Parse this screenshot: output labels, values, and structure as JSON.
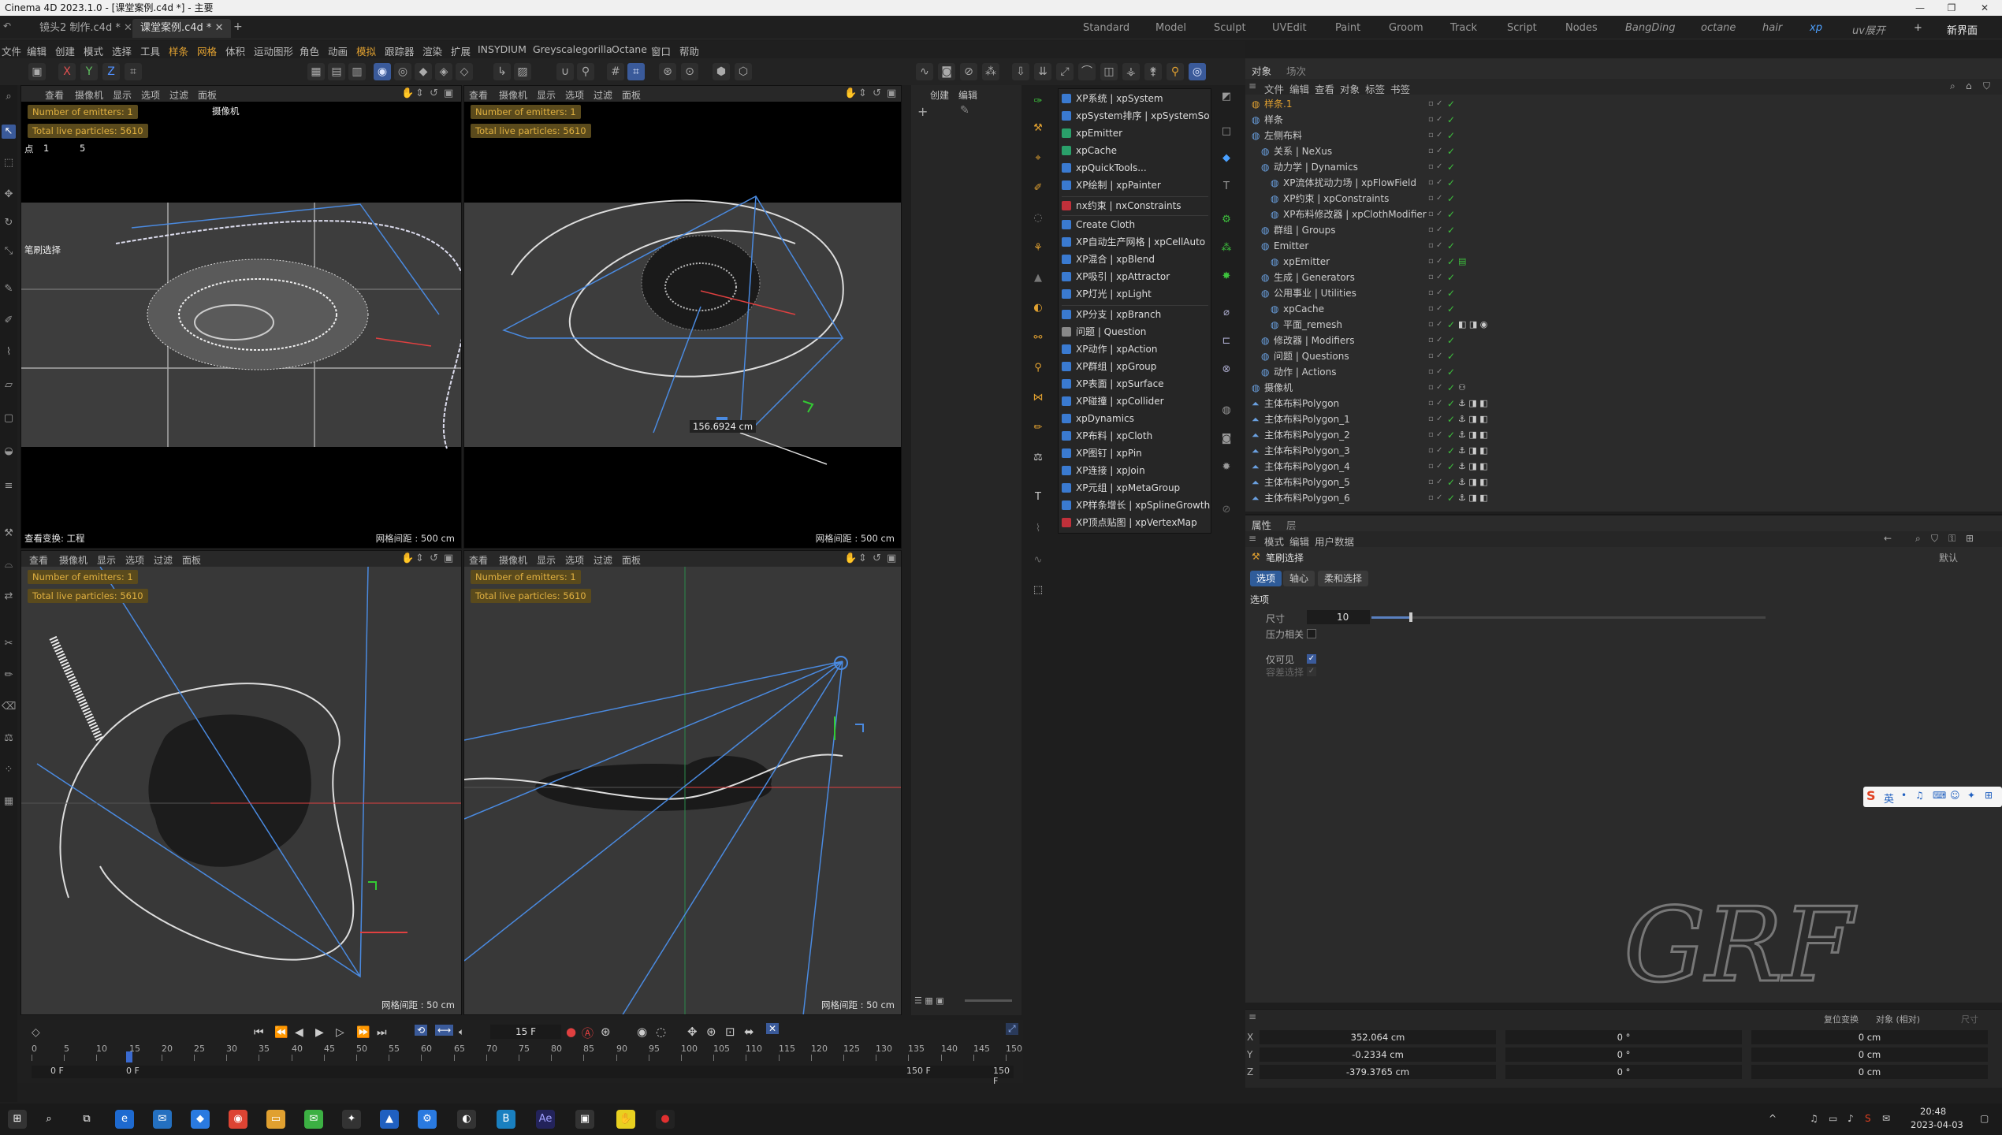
{
  "window": {
    "title": "Cinema 4D 2023.1.0 - [课堂案例.c4d *] - 主要"
  },
  "doc_tabs": [
    {
      "label": "镜头2 制作.c4d *"
    },
    {
      "label": "课堂案例.c4d *"
    }
  ],
  "layouts": [
    "Standard",
    "Model",
    "Sculpt",
    "UVEdit",
    "Paint",
    "Groom",
    "Track",
    "Script",
    "Nodes",
    "BangDing",
    "octane",
    "hair",
    "xp",
    "uv展开",
    "+",
    "新界面"
  ],
  "menu": [
    "文件",
    "编辑",
    "创建",
    "模式",
    "选择",
    "工具",
    "样条",
    "网格",
    "体积",
    "运动图形",
    "角色",
    "动画",
    "模拟",
    "跟踪器",
    "渲染",
    "扩展",
    "INSYDIUM",
    "Greyscalegorilla",
    "Octane",
    "窗口",
    "帮助"
  ],
  "viewport_menu": [
    "查看",
    "摄像机",
    "显示",
    "选项",
    "过滤",
    "面板"
  ],
  "hud": {
    "emitters": "Number of emitters: 1",
    "particles": "Total live particles: 5610"
  },
  "viewports": [
    {
      "grid": "网格间距 : 500 cm",
      "camera": "摄像机",
      "extra": "点",
      "n1": "1",
      "n2": "5",
      "sel": "笔刷选择",
      "transform": "查看变换: 工程"
    },
    {
      "grid": "网格间距 : 500 cm",
      "measure": "156.6924 cm"
    },
    {
      "grid": "网格间距 : 50 cm"
    },
    {
      "grid": "网格间距 : 50 cm"
    }
  ],
  "create_panel": {
    "tab1": "创建",
    "tab2": "编辑"
  },
  "xp_menu": [
    {
      "label": "XP系统 | xpSystem",
      "color": "#3a7ad0"
    },
    {
      "label": "xpSystem排序 | xpSystemSort",
      "color": "#3a7ad0"
    },
    {
      "label": "xpEmitter",
      "color": "#2aa06a"
    },
    {
      "label": "xpCache",
      "color": "#2aa06a"
    },
    {
      "label": "xpQuickTools...",
      "color": "#3a7ad0"
    },
    {
      "label": "XP绘制 | xpPainter",
      "color": "#3a7ad0"
    },
    {
      "label": "nx约束 | nxConstraints",
      "color": "#c0303a"
    },
    {
      "label": "Create Cloth",
      "color": "#3a7ad0"
    },
    {
      "label": "XP自动生产网格 | xpCellAuto",
      "color": "#3a7ad0"
    },
    {
      "label": "XP混合 | xpBlend",
      "color": "#3a7ad0"
    },
    {
      "label": "XP吸引 | xpAttractor",
      "color": "#3a7ad0"
    },
    {
      "label": "XP灯光 | xpLight",
      "color": "#3a7ad0"
    },
    {
      "label": "XP分支 | xpBranch",
      "color": "#3a7ad0"
    },
    {
      "label": "问题 | Question",
      "color": "#888888"
    },
    {
      "label": "XP动作 | xpAction",
      "color": "#3a7ad0"
    },
    {
      "label": "XP群组 | xpGroup",
      "color": "#3a7ad0"
    },
    {
      "label": "XP表面 | xpSurface",
      "color": "#3a7ad0"
    },
    {
      "label": "XP碰撞 | xpCollider",
      "color": "#3a7ad0"
    },
    {
      "label": "xpDynamics",
      "color": "#3a7ad0"
    },
    {
      "label": "XP布料 | xpCloth",
      "color": "#3a7ad0"
    },
    {
      "label": "XP图钉 | xpPin",
      "color": "#3a7ad0"
    },
    {
      "label": "XP连接 | xpJoin",
      "color": "#3a7ad0"
    },
    {
      "label": "XP元组 | xpMetaGroup",
      "color": "#3a7ad0"
    },
    {
      "label": "XP样条增长 | xpSplineGrowth",
      "color": "#3a7ad0"
    },
    {
      "label": "XP顶点贴图 | xpVertexMap",
      "color": "#c0303a"
    }
  ],
  "obj_panel": {
    "tabs": [
      "对象",
      "场次"
    ],
    "menu": [
      "文件",
      "编辑",
      "查看",
      "对象",
      "标签",
      "书签"
    ],
    "rows": [
      {
        "label": "样条.1",
        "color": "#e0a030"
      },
      {
        "label": "样条",
        "color": "#ccc"
      },
      {
        "label": "左侧布料",
        "color": "#ccc"
      },
      {
        "label": "关系 | NeXus",
        "color": "#ccc"
      },
      {
        "label": "动力学 | Dynamics",
        "color": "#ccc"
      },
      {
        "label": "XP流体扰动力场 | xpFlowField",
        "color": "#ccc"
      },
      {
        "label": "XP约束 | xpConstraints",
        "color": "#ccc"
      },
      {
        "label": "XP布料修改器 | xpClothModifier",
        "color": "#ccc"
      },
      {
        "label": "群组 | Groups",
        "color": "#ccc"
      },
      {
        "label": "Emitter",
        "color": "#ccc"
      },
      {
        "label": "xpEmitter",
        "color": "#ccc"
      },
      {
        "label": "生成 | Generators",
        "color": "#ccc"
      },
      {
        "label": "公用事业 | Utilities",
        "color": "#ccc"
      },
      {
        "label": "xpCache",
        "color": "#ccc"
      },
      {
        "label": "平面_remesh",
        "color": "#ccc"
      },
      {
        "label": "修改器 | Modifiers",
        "color": "#ccc"
      },
      {
        "label": "问题 | Questions",
        "color": "#ccc"
      },
      {
        "label": "动作 | Actions",
        "color": "#ccc"
      },
      {
        "label": "摄像机",
        "color": "#ccc"
      },
      {
        "label": "主体布料Polygon",
        "color": "#ccc"
      },
      {
        "label": "主体布料Polygon_1",
        "color": "#ccc"
      },
      {
        "label": "主体布料Polygon_2",
        "color": "#ccc"
      },
      {
        "label": "主体布料Polygon_3",
        "color": "#ccc"
      },
      {
        "label": "主体布料Polygon_4",
        "color": "#ccc"
      },
      {
        "label": "主体布料Polygon_5",
        "color": "#ccc"
      },
      {
        "label": "主体布料Polygon_6",
        "color": "#ccc"
      }
    ]
  },
  "attr_panel": {
    "tabs": [
      "属性",
      "层"
    ],
    "menu": [
      "模式",
      "编辑",
      "用户数据"
    ],
    "title": "笔刷选择",
    "buttons": [
      "选项",
      "轴心",
      "柔和选择"
    ],
    "section": "选项",
    "size_label": "尺寸",
    "size_value": "10",
    "size_pct": 0.1,
    "pressure_label": "压力相关",
    "visible_label": "仅可见",
    "tolerance_label": "容差选择",
    "default_label": "默认"
  },
  "coord": {
    "left_btn": "复位变换",
    "mode": "对象 (相对)",
    "size_btn": "尺寸",
    "rows": [
      {
        "axis": "X",
        "pos": "352.064 cm",
        "rot": "0 °",
        "scale": "0 cm"
      },
      {
        "axis": "Y",
        "pos": "-0.2334 cm",
        "rot": "0 °",
        "scale": "0 cm"
      },
      {
        "axis": "Z",
        "pos": "-379.3765 cm",
        "rot": "0 °",
        "scale": "0 cm"
      }
    ]
  },
  "timeline": {
    "ticks": [
      "0",
      "5",
      "10",
      "15",
      "20",
      "25",
      "30",
      "35",
      "40",
      "45",
      "50",
      "55",
      "60",
      "65",
      "70",
      "75",
      "80",
      "85",
      "90",
      "95",
      "100",
      "105",
      "110",
      "115",
      "120",
      "125",
      "130",
      "135",
      "140",
      "145",
      "150"
    ],
    "current_frame": "15 F",
    "start": "0 F",
    "start2": "0 F",
    "end": "150 F",
    "end2": "150 F",
    "playhead_frame": 15,
    "max_frame": 150
  },
  "watermark": "GRF",
  "tray": {
    "time": "20:48",
    "date": "2023-04-03"
  }
}
